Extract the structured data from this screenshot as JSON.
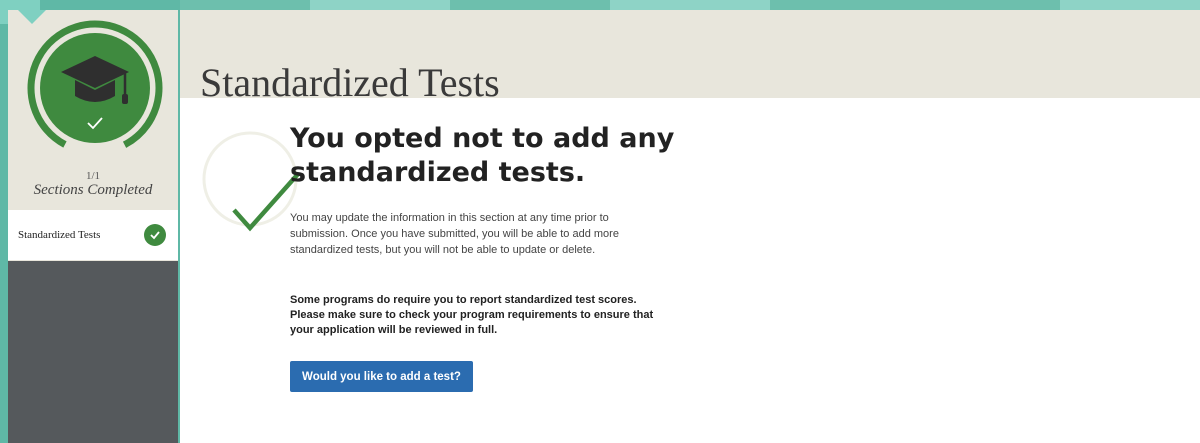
{
  "page": {
    "title": "Standardized Tests"
  },
  "progress": {
    "count": "1/1",
    "label": "Sections Completed",
    "fraction": 1.0
  },
  "sidebar": {
    "items": [
      {
        "label": "Standardized Tests",
        "status_icon": "check-circle-icon",
        "complete": true
      }
    ]
  },
  "main": {
    "headline": "You opted not to add any standardized tests.",
    "paragraph": "You may update the information in this section at any time prior to submission. Once you have submitted, you will be able to add more standardized tests, but you will not be able to update or delete.",
    "notice": "Some programs do require you to report standardized test scores. Please make sure to check your program requirements to ensure that your application will be reviewed in full.",
    "add_button_label": "Would you like to add a test?"
  },
  "icons": {
    "progress_icon": "graduation-cap-icon",
    "status_icon": "checkmark-icon"
  },
  "colors": {
    "accent_green": "#3f8a3f",
    "button_blue": "#2b6cb0",
    "background_teal": "#5fb8a6",
    "panel_beige": "#e8e6dc",
    "sidebar_dark": "#55595c"
  }
}
